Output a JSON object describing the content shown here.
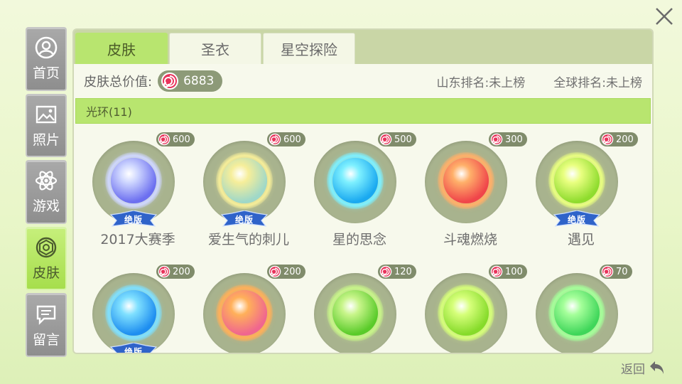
{
  "close": {
    "icon": "close-icon"
  },
  "nav": [
    {
      "label": "首页",
      "icon": "profile-icon",
      "active": false
    },
    {
      "label": "照片",
      "icon": "photo-icon",
      "active": false
    },
    {
      "label": "游戏",
      "icon": "atom-icon",
      "active": false
    },
    {
      "label": "皮肤",
      "icon": "skin-icon",
      "active": true
    },
    {
      "label": "留言",
      "icon": "message-icon",
      "active": false
    }
  ],
  "tabs": [
    {
      "label": "皮肤",
      "active": true
    },
    {
      "label": "圣衣",
      "active": false
    },
    {
      "label": "星空探险",
      "active": false
    }
  ],
  "summary": {
    "total_label": "皮肤总价值:",
    "total_value": "6883",
    "province_rank": "山东排名:未上榜",
    "global_rank": "全球排名:未上榜"
  },
  "section": {
    "label": "光环(11)"
  },
  "items": [
    {
      "name": "2017大赛季",
      "price": "600",
      "limited": true,
      "color": "#6c6ff0",
      "glow": "#cfd7ff"
    },
    {
      "name": "爱生气的刺儿",
      "price": "600",
      "limited": true,
      "color": "#9fd8c8",
      "glow": "#f6ee9a"
    },
    {
      "name": "星的思念",
      "price": "500",
      "limited": false,
      "color": "#1aa9f0",
      "glow": "#7ef0ff"
    },
    {
      "name": "斗魂燃烧",
      "price": "300",
      "limited": false,
      "color": "#f0454a",
      "glow": "#ffb06a"
    },
    {
      "name": "遇见",
      "price": "200",
      "limited": true,
      "color": "#8fdc2e",
      "glow": "#e9ff80"
    },
    {
      "name": "",
      "price": "200",
      "limited": true,
      "color": "#1e8ef0",
      "glow": "#7fe0ff"
    },
    {
      "name": "",
      "price": "200",
      "limited": false,
      "color": "#f0668f",
      "glow": "#ffb05a"
    },
    {
      "name": "",
      "price": "120",
      "limited": false,
      "color": "#5acb2a",
      "glow": "#c8f58a"
    },
    {
      "name": "",
      "price": "100",
      "limited": false,
      "color": "#86db2a",
      "glow": "#d6ff7a"
    },
    {
      "name": "",
      "price": "70",
      "limited": false,
      "color": "#3fd65a",
      "glow": "#a5ff9a"
    }
  ],
  "limited_label": "绝版",
  "back": {
    "label": "返回",
    "icon": "back-arrow-icon"
  },
  "colors": {
    "accent": "#b8e56f",
    "nav_inactive": "#9a9a9a",
    "badge": "#808c6b"
  }
}
